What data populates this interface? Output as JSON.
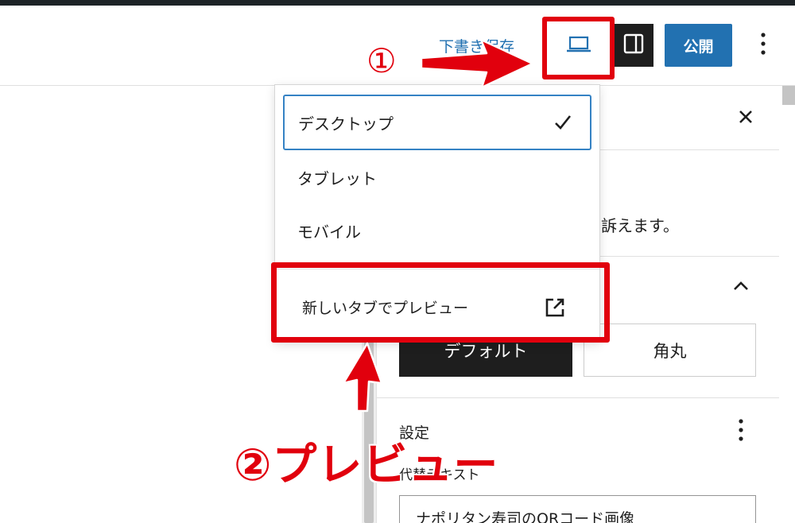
{
  "header": {
    "save_draft_label": "下書き保存",
    "publish_label": "公開",
    "preview_icon": "laptop-icon",
    "sidebar_icon": "sidebar-toggle-icon",
    "more_icon": "more-vertical-icon"
  },
  "preview_menu": {
    "items": [
      {
        "label": "デスクトップ",
        "selected": true
      },
      {
        "label": "タブレット",
        "selected": false
      },
      {
        "label": "モバイル",
        "selected": false
      }
    ],
    "new_tab_label": "新しいタブでプレビュー",
    "check_icon": "check-icon",
    "external_icon": "external-link-icon"
  },
  "settings_panel": {
    "description_fragment": "に訴えます。",
    "styles": [
      "デフォルト",
      "角丸"
    ],
    "settings_label": "設定",
    "alt_text_label": "代替テキスト",
    "alt_text_value": "ナポリタン寿司のQRコード画像"
  },
  "annotations": {
    "step1": "①",
    "step2": "②プレビュー",
    "highlight_color": "#e1000d"
  },
  "colors": {
    "accent": "#2271b1",
    "dark": "#1e1e1e",
    "focus": "#3582c4"
  }
}
